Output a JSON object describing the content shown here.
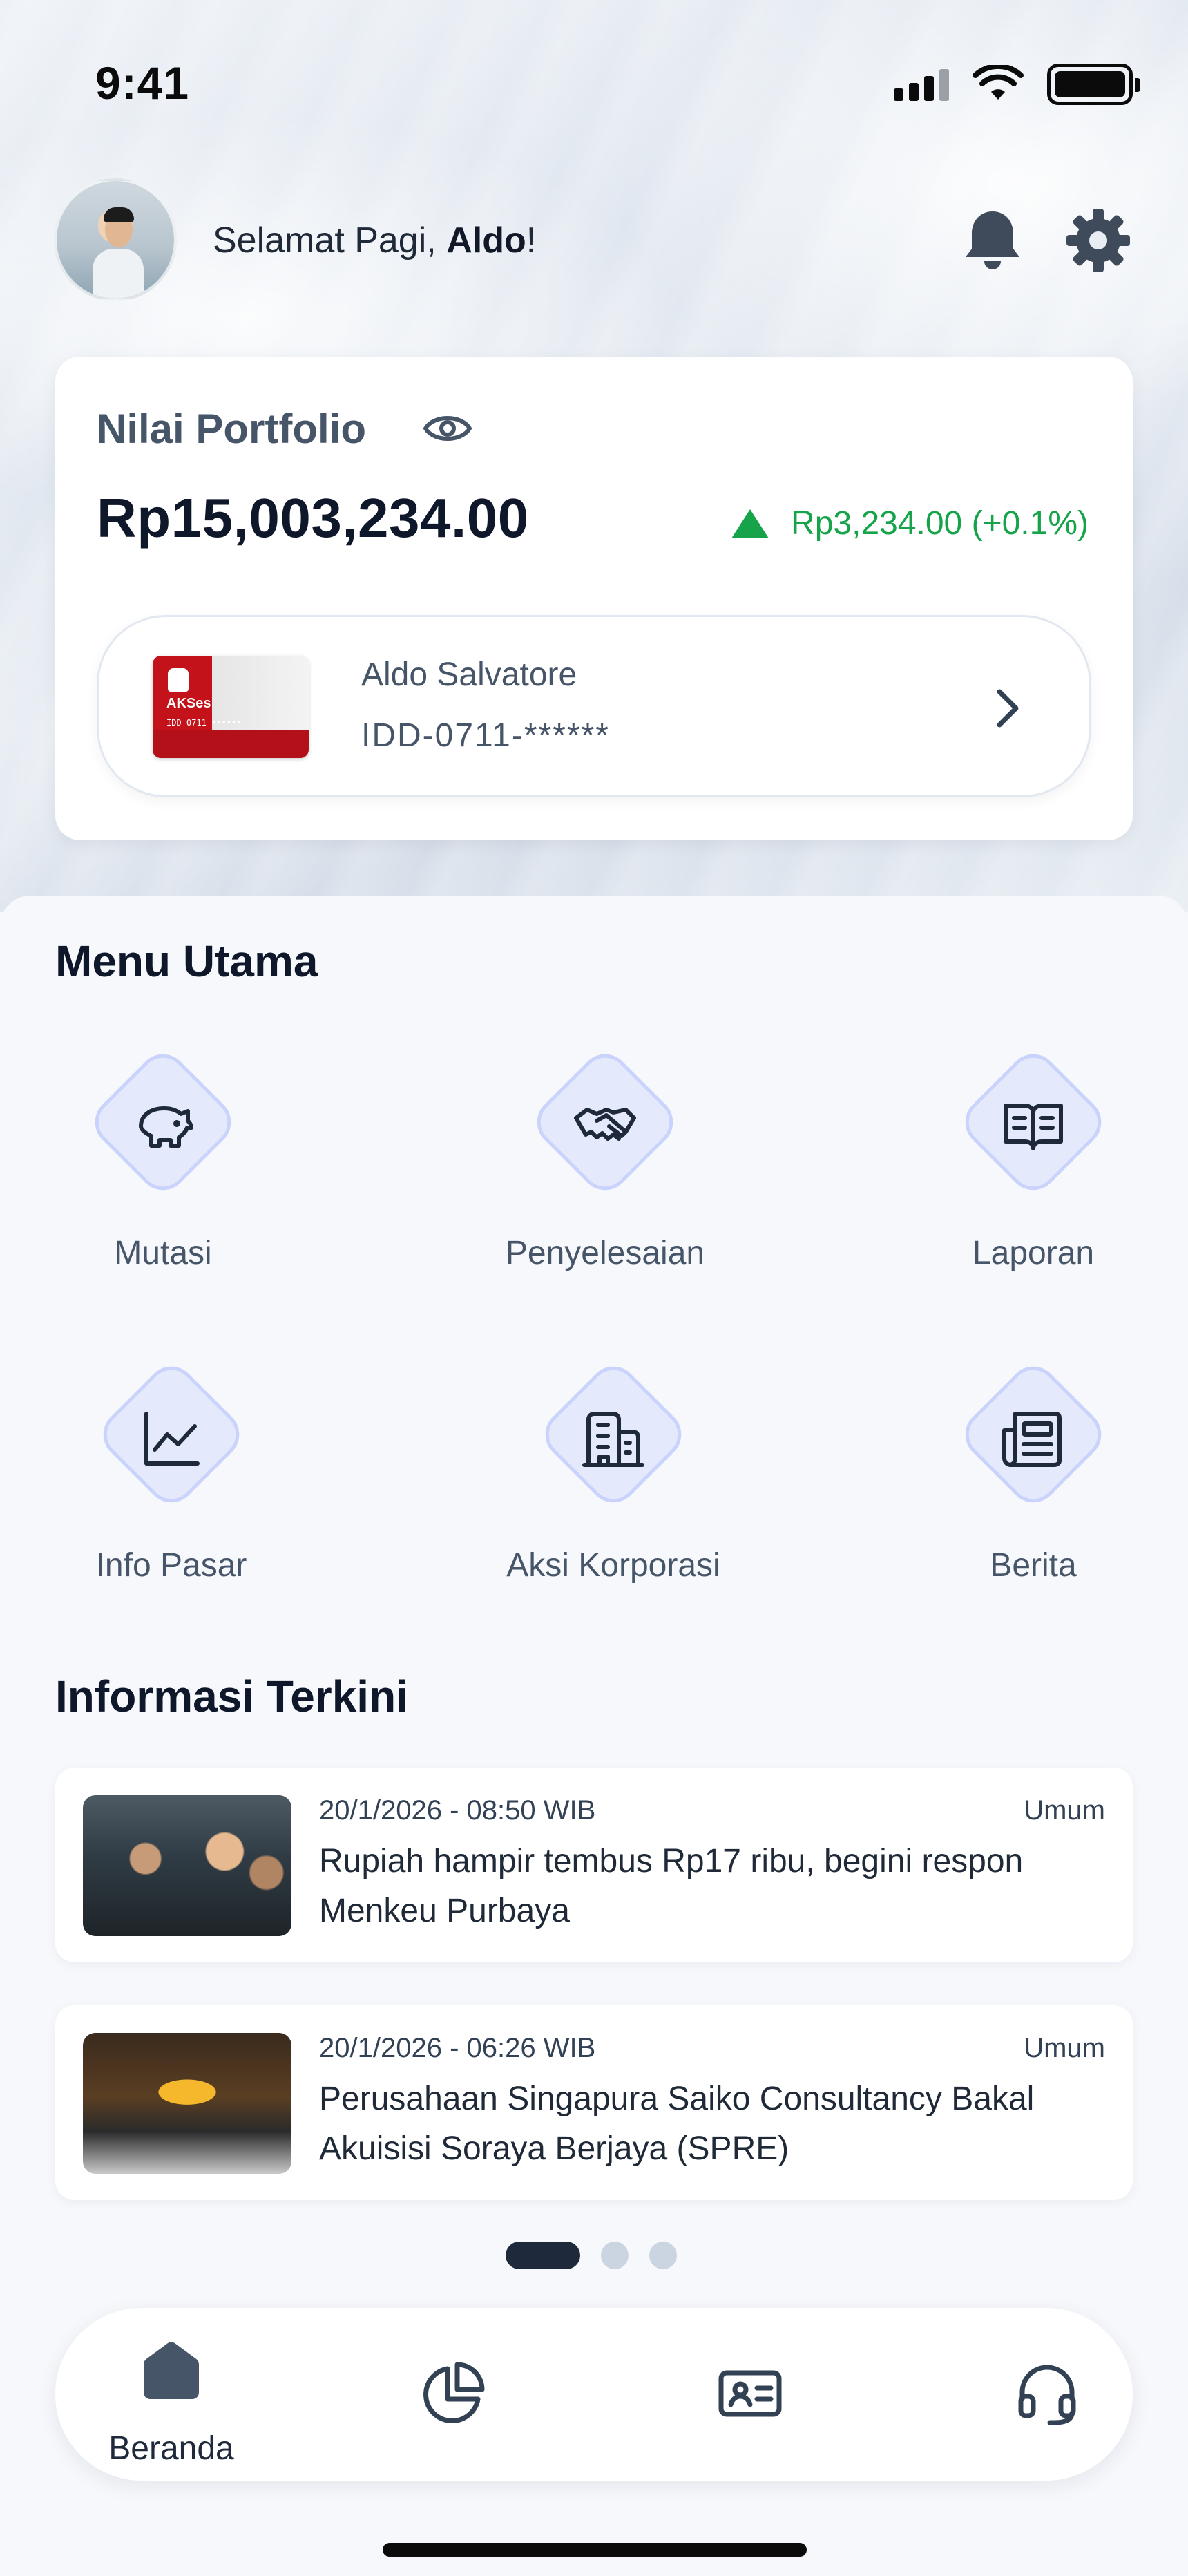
{
  "status_bar": {
    "time": "9:41"
  },
  "header": {
    "greeting_prefix": "Selamat Pagi, ",
    "user_name": "Aldo",
    "greeting_suffix": "!"
  },
  "portfolio": {
    "title": "Nilai Portfolio",
    "value": "Rp15,003,234.00",
    "change": "Rp3,234.00 (+0.1%)",
    "account": {
      "name": "Aldo Salvatore",
      "id": "IDD-0711-******",
      "card_brand": "AKSes"
    }
  },
  "menu": {
    "title": "Menu Utama",
    "items": [
      {
        "label": "Mutasi",
        "icon": "piggy-bank-icon"
      },
      {
        "label": "Penyelesaian",
        "icon": "handshake-icon"
      },
      {
        "label": "Laporan",
        "icon": "book-open-icon"
      },
      {
        "label": "Info Pasar",
        "icon": "line-chart-icon"
      },
      {
        "label": "Aksi Korporasi",
        "icon": "building-icon"
      },
      {
        "label": "Berita",
        "icon": "newspaper-icon"
      }
    ]
  },
  "news": {
    "title": "Informasi Terkini",
    "items": [
      {
        "time": "20/1/2026 - 08:50 WIB",
        "category": "Umum",
        "headline": "Rupiah hampir tembus Rp17 ribu, begini respon Menkeu Purbaya"
      },
      {
        "time": "20/1/2026 - 06:26 WIB",
        "category": "Umum",
        "headline": "Perusahaan Singapura Saiko Consultancy Bakal Akuisisi Soraya Berjaya (SPRE)"
      }
    ],
    "pager": {
      "active": 1,
      "total": 3
    }
  },
  "bottom_nav": {
    "items": [
      {
        "label": "Beranda",
        "icon": "home-icon",
        "active": true
      },
      {
        "label": "",
        "icon": "pie-chart-icon",
        "active": false
      },
      {
        "label": "",
        "icon": "id-card-icon",
        "active": false
      },
      {
        "label": "",
        "icon": "headset-icon",
        "active": false
      }
    ]
  },
  "colors": {
    "positive": "#16a34a",
    "accent_tile": "#e4e9fc",
    "dark": "#0f172a"
  }
}
